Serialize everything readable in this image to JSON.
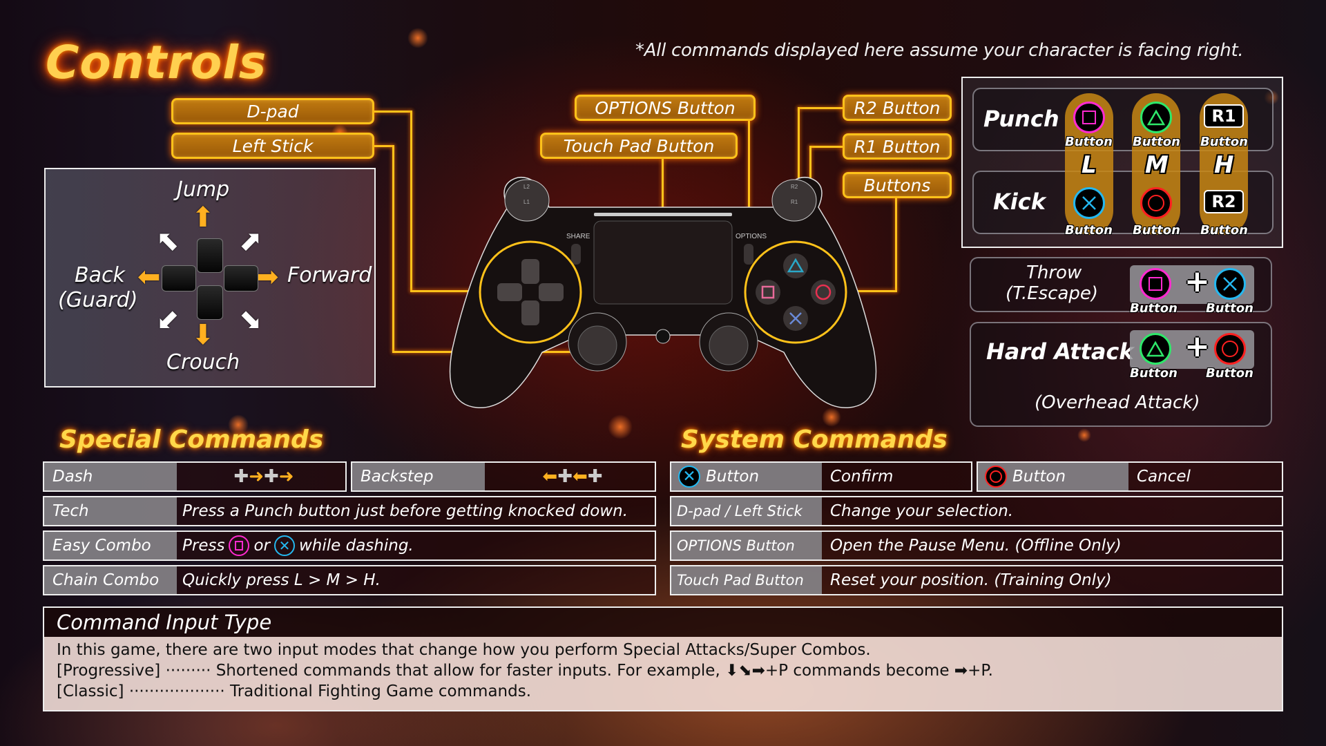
{
  "header": {
    "title": "Controls",
    "note": "*All commands displayed here assume your character is facing right."
  },
  "callouts": {
    "dpad": "D-pad",
    "left_stick": "Left Stick",
    "options": "OPTIONS Button",
    "touch_pad": "Touch Pad Button",
    "r2": "R2 Button",
    "r1": "R1 Button",
    "buttons": "Buttons"
  },
  "controller": {
    "share_label": "SHARE",
    "options_label": "OPTIONS",
    "l2": "L2",
    "l1": "L1",
    "r2": "R2",
    "r1": "R1"
  },
  "directions": {
    "up": "Jump",
    "back": "Back",
    "back_sub": "(Guard)",
    "forward": "Forward",
    "down": "Crouch"
  },
  "attack_grid": {
    "punch_label": "Punch",
    "kick_label": "Kick",
    "strengths": [
      "L",
      "M",
      "H"
    ],
    "button_caption": "Button",
    "punch_buttons": [
      "square",
      "triangle",
      "R1"
    ],
    "kick_buttons": [
      "cross",
      "circle",
      "R2"
    ]
  },
  "throw": {
    "label": "Throw",
    "sub": "(T.Escape)",
    "buttons": [
      "square",
      "cross"
    ],
    "caption": "Button"
  },
  "hard_attack": {
    "label": "Hard Attack",
    "sub": "(Overhead Attack)",
    "buttons": [
      "triangle",
      "circle"
    ],
    "caption": "Button"
  },
  "special_commands": {
    "title": "Special Commands",
    "dash": "Dash",
    "backstep": "Backstep",
    "rows": [
      {
        "key": "Tech",
        "value": "Press a Punch button just before getting knocked down."
      },
      {
        "key": "Easy Combo",
        "value_pre": "Press",
        "value_mid": "or",
        "value_post": "while dashing."
      },
      {
        "key": "Chain Combo",
        "value": "Quickly press L > M > H."
      }
    ]
  },
  "system_commands": {
    "title": "System Commands",
    "confirm_key": "Button",
    "confirm_value": "Confirm",
    "cancel_key": "Button",
    "cancel_value": "Cancel",
    "rows": [
      {
        "key": "D-pad / Left Stick",
        "value": "Change your selection."
      },
      {
        "key": "OPTIONS Button",
        "value": "Open the Pause Menu. (Offline Only)"
      },
      {
        "key": "Touch Pad Button",
        "value": "Reset your position. (Training Only)"
      }
    ]
  },
  "command_input_type": {
    "title": "Command Input Type",
    "intro": "In this game, there are two input modes that change how you perform Special Attacks/Super Combos.",
    "progressive_label": "[Progressive]",
    "progressive_dots": "·········",
    "progressive_text_pre": "Shortened commands that allow for faster inputs. For example,",
    "progressive_cmd": "⬇⬊➡",
    "progressive_text_mid": "+P commands become",
    "progressive_cmd2": "➡",
    "progressive_text_post": "+P.",
    "classic_label": "[Classic]",
    "classic_dots": "···················",
    "classic_text": "Traditional Fighting Game commands."
  },
  "colors": {
    "accent_orange": "#ffc21a",
    "title_yellow": "#ffd050",
    "square": "#ff2ad0",
    "triangle": "#2ee86a",
    "cross": "#24b8f0",
    "circle": "#ff2020"
  }
}
